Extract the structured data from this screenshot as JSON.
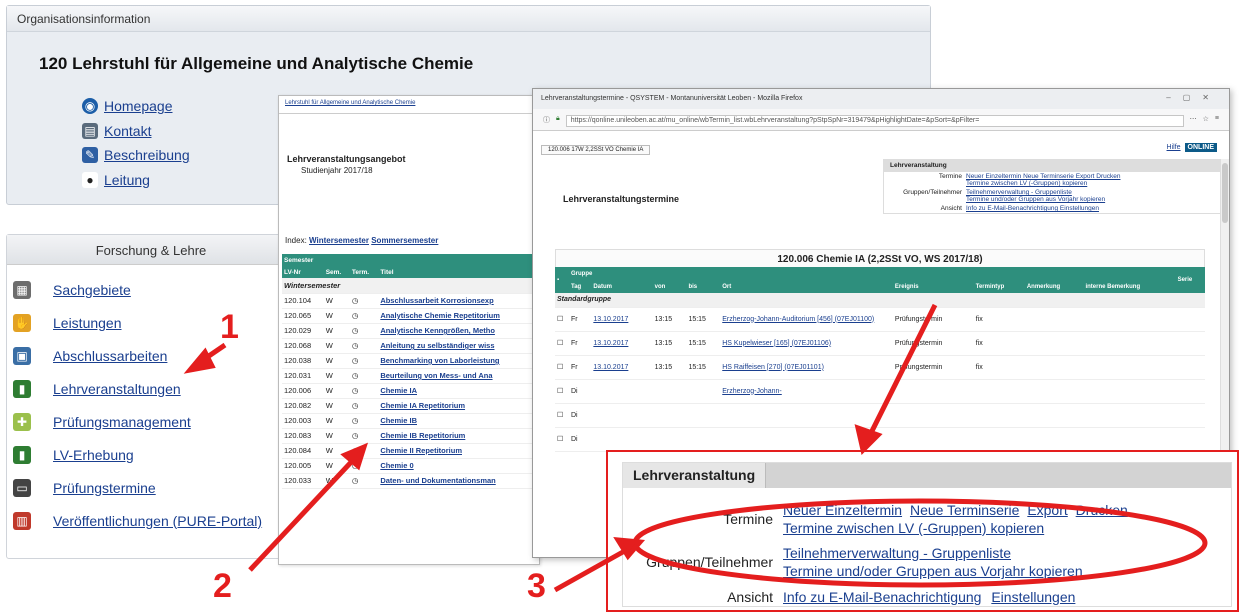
{
  "org": {
    "header": "Organisationsinformation",
    "title": "120  Lehrstuhl für Allgemeine und Analytische Chemie",
    "links": [
      {
        "label": "Homepage",
        "icon": "globe-icon",
        "color": "#1c5ea8"
      },
      {
        "label": "Kontakt",
        "icon": "contact-card-icon",
        "color": "#5a6b7c"
      },
      {
        "label": "Beschreibung",
        "icon": "document-icon",
        "color": "#2e5fa3"
      },
      {
        "label": "Leitung",
        "icon": "person-icon",
        "color": "#222222"
      }
    ]
  },
  "forschung": {
    "header": "Forschung & Lehre",
    "items": [
      {
        "label": "Sachgebiete",
        "icon": "sitemap-icon",
        "color": "#6d6d6d"
      },
      {
        "label": "Leistungen",
        "icon": "hand-icon",
        "color": "#e3a224"
      },
      {
        "label": "Abschlussarbeiten",
        "icon": "thesis-icon",
        "color": "#3a6ea5"
      },
      {
        "label": "Lehrveranstaltungen",
        "icon": "people-chart-icon",
        "color": "#2e7d32"
      },
      {
        "label": "Prüfungsmanagement",
        "icon": "puzzle-icon",
        "color": "#9bc04c"
      },
      {
        "label": "LV-Erhebung",
        "icon": "people-chart-icon",
        "color": "#2e7d32"
      },
      {
        "label": "Prüfungstermine",
        "icon": "printer-icon",
        "color": "#444444"
      },
      {
        "label": "Veröffentlichungen (PURE-Portal)",
        "icon": "publication-icon",
        "color": "#c0392b"
      }
    ]
  },
  "lv": {
    "tab": "Lehrstuhl für Allgemeine und Analytische Chemie",
    "heading": "Lehrveranstaltungsangebot",
    "studienjahr": "Studienjahr 2017/18",
    "index_label": "Index:",
    "index_links": [
      "Wintersemester",
      "Sommersemester"
    ],
    "section_header": "Semester",
    "columns": [
      "LV-Nr",
      "Sem.",
      "Term.",
      "Titel"
    ],
    "group": "Wintersemester",
    "rows": [
      {
        "nr": "120.104",
        "sem": "W",
        "title": "Abschlussarbeit Korrosionsexp"
      },
      {
        "nr": "120.065",
        "sem": "W",
        "title": "Analytische Chemie Repetitorium"
      },
      {
        "nr": "120.029",
        "sem": "W",
        "title": "Analytische Kenngrößen, Metho"
      },
      {
        "nr": "120.068",
        "sem": "W",
        "title": "Anleitung zu selbständiger wiss"
      },
      {
        "nr": "120.038",
        "sem": "W",
        "title": "Benchmarking von Laborleistung"
      },
      {
        "nr": "120.031",
        "sem": "W",
        "title": "Beurteilung von Mess- und Ana"
      },
      {
        "nr": "120.006",
        "sem": "W",
        "title": "Chemie IA"
      },
      {
        "nr": "120.082",
        "sem": "W",
        "title": "Chemie IA Repetitorium"
      },
      {
        "nr": "120.003",
        "sem": "W",
        "title": "Chemie IB"
      },
      {
        "nr": "120.083",
        "sem": "W",
        "title": "Chemie IB Repetitorium"
      },
      {
        "nr": "120.084",
        "sem": "W",
        "title": "Chemie II Repetitorium"
      },
      {
        "nr": "120.005",
        "sem": "W",
        "title": "Chemie 0"
      },
      {
        "nr": "120.033",
        "sem": "W",
        "title": "Daten- und Dokumentationsman"
      }
    ]
  },
  "ff": {
    "window_title": "Lehrveranstaltungstermine - QSYSTEM - Montanuniversität Leoben - Mozilla Firefox",
    "url": "https://qonline.unileoben.ac.at/mu_online/wbTermin_list.wbLehrveranstaltung?pStpSpNr=319479&pHighlightDate=&pSort=&pFilter=",
    "breadcrumb_tab": "120.006 17W 2,2SSt VO Chemie IA",
    "brand_hilfe": "Hilfe",
    "brand": "ONLINE",
    "page_heading": "Lehrveranstaltungstermine",
    "mini_header": "Lehrveranstaltung",
    "mini_rows": [
      {
        "label": "Termine",
        "links": [
          "Neuer Einzeltermin  Neue Terminserie  Export  Drucken",
          "Termine zwischen LV (-Gruppen) kopieren"
        ]
      },
      {
        "label": "Gruppen/Teilnehmer",
        "links": [
          "Teilnehmerverwaltung - Gruppenliste",
          "Termine und/oder Gruppen aus Vorjahr kopieren"
        ]
      },
      {
        "label": "Ansicht",
        "links": [
          "Info zu E-Mail-Benachrichtigung  Einstellungen"
        ]
      }
    ],
    "caption": "120.006 Chemie IA (2,2SSt VO, WS 2017/18)",
    "columns": [
      "Tag",
      "Datum",
      "von",
      "bis",
      "Ort",
      "Ereignis",
      "Termintyp",
      "Anmerkung",
      "interne Bemerkung",
      "Serie"
    ],
    "group_header": "Gruppe",
    "group_name": "Standardgruppe",
    "rows": [
      {
        "tag": "Fr",
        "datum": "13.10.2017",
        "von": "13:15",
        "bis": "15:15",
        "ort": "Erzherzog-Johann-Auditorium [456] (07EJ01100)",
        "ereignis": "Prüfungstermin",
        "typ": "fix"
      },
      {
        "tag": "Fr",
        "datum": "13.10.2017",
        "von": "13:15",
        "bis": "15:15",
        "ort": "HS Kupelwieser [165] (07EJ01106)",
        "ereignis": "Prüfungstermin",
        "typ": "fix"
      },
      {
        "tag": "Fr",
        "datum": "13.10.2017",
        "von": "13:15",
        "bis": "15:15",
        "ort": "HS Raiffeisen [270] (07EJ01101)",
        "ereignis": "Prüfungstermin",
        "typ": "fix"
      },
      {
        "tag": "Di",
        "datum": "",
        "von": "",
        "bis": "",
        "ort": "Erzherzog-Johann-",
        "ereignis": "",
        "typ": ""
      },
      {
        "tag": "Di",
        "datum": "",
        "von": "",
        "bis": "",
        "ort": "",
        "ereignis": "",
        "typ": ""
      },
      {
        "tag": "Di",
        "datum": "",
        "von": "",
        "bis": "",
        "ort": "",
        "ereignis": "",
        "typ": ""
      }
    ]
  },
  "zoom": {
    "header": "Lehrveranstaltung",
    "termine_label": "Termine",
    "termine_links": [
      "Neuer Einzeltermin",
      "Neue Terminserie",
      "Export",
      "Drucken"
    ],
    "termine_link2": "Termine zwischen LV (-Gruppen) kopieren",
    "gruppen_label": "Gruppen/Teilnehmer",
    "gruppen_link1": "Teilnehmerverwaltung - Gruppenliste",
    "gruppen_link2": "Termine und/oder Gruppen aus Vorjahr kopieren",
    "ansicht_label": "Ansicht",
    "ansicht_link1": "Info zu E-Mail-Benachrichtigung",
    "ansicht_link2": "Einstellungen"
  },
  "annotations": {
    "one": "1",
    "two": "2",
    "three": "3",
    "color": "#e41e1e"
  }
}
